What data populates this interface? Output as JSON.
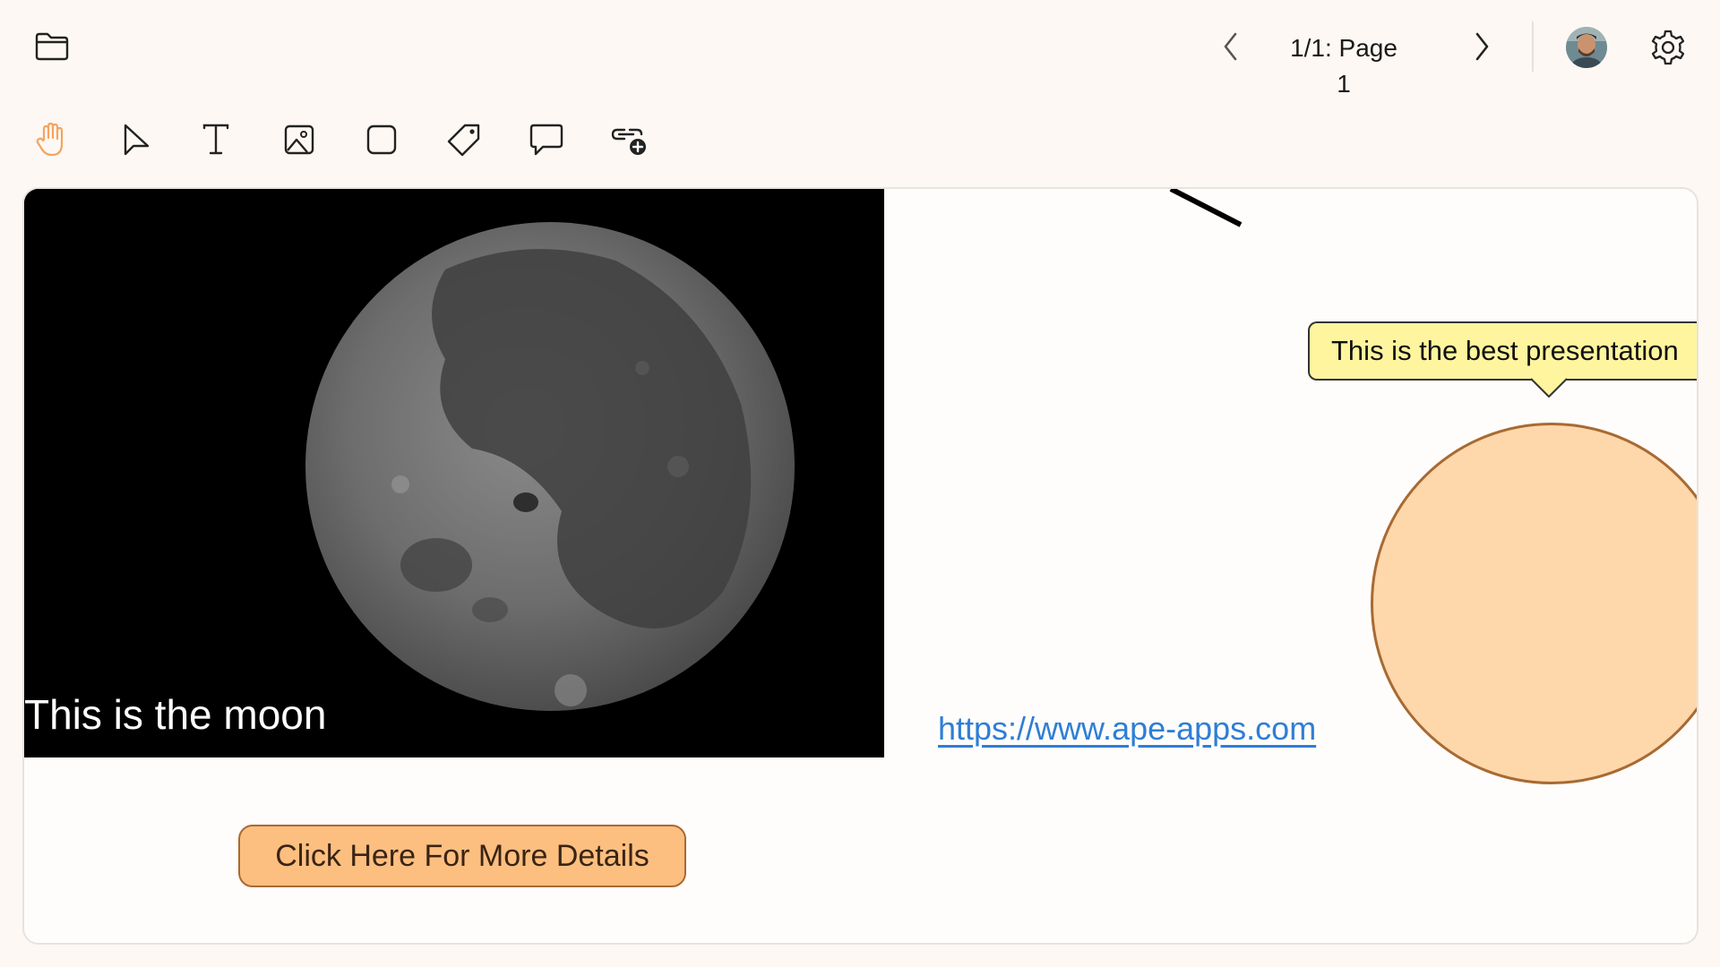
{
  "header": {
    "page_indicator": "1/1: Page 1"
  },
  "icons": {
    "open": "folder-icon",
    "prev": "chevron-left-icon",
    "next": "chevron-right-icon",
    "settings": "gear-icon"
  },
  "tools": [
    {
      "name": "pan",
      "icon": "hand-icon",
      "active": true
    },
    {
      "name": "select",
      "icon": "pointer-icon"
    },
    {
      "name": "text",
      "icon": "text-icon"
    },
    {
      "name": "image",
      "icon": "image-icon"
    },
    {
      "name": "shape",
      "icon": "square-icon"
    },
    {
      "name": "tag",
      "icon": "tag-icon"
    },
    {
      "name": "callout",
      "icon": "speech-bubble-icon"
    },
    {
      "name": "add-link",
      "icon": "link-add-icon"
    }
  ],
  "canvas": {
    "moon_caption": "This is the moon",
    "link_text": "https://www.ape-apps.com",
    "button_label": "Click Here For More Details",
    "callout_text": "This is the best presentation"
  },
  "colors": {
    "background": "#fdf8f3",
    "active_tool": "#f4a460",
    "link": "#2e7ed6",
    "button_fill": "#fdbf80",
    "callout_fill": "#fff59e",
    "circle_fill": "#fed7ab",
    "circle_stroke": "#a86a32"
  }
}
